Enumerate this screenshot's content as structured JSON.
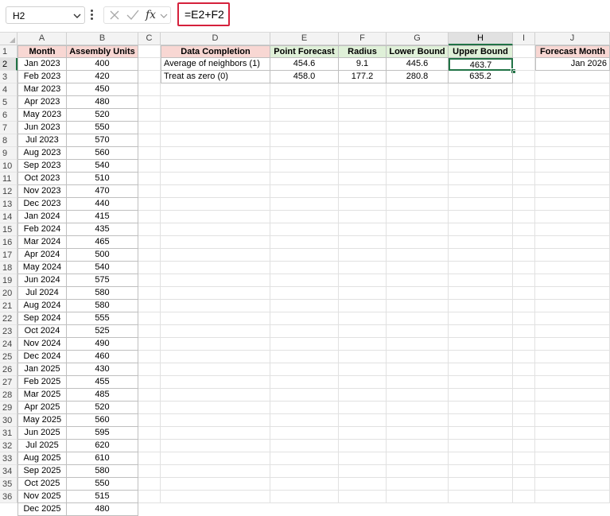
{
  "formula_bar": {
    "name_box": "H2",
    "formula": "=E2+F2",
    "fx_label": "fx",
    "icons": [
      "chevron-down-icon",
      "more-dots-icon",
      "cancel-x-icon",
      "confirm-check-icon",
      "function-fx-icon"
    ]
  },
  "columns": [
    "A",
    "B",
    "C",
    "D",
    "E",
    "F",
    "G",
    "H",
    "I",
    "J"
  ],
  "row_numbers": [
    "1",
    "2",
    "3",
    "4",
    "5",
    "6",
    "7",
    "8",
    "9",
    "10",
    "11",
    "12",
    "13",
    "14",
    "15",
    "16",
    "17",
    "18",
    "19",
    "20",
    "21",
    "22",
    "23",
    "24",
    "25",
    "26",
    "27",
    "28",
    "29",
    "30",
    "31",
    "32",
    "33",
    "34",
    "35",
    "36"
  ],
  "table_a": {
    "headers": [
      "Month",
      "Assembly Units"
    ],
    "rows": [
      [
        "Jan 2023",
        "400"
      ],
      [
        "Feb 2023",
        "420"
      ],
      [
        "Mar 2023",
        "450"
      ],
      [
        "Apr 2023",
        "480"
      ],
      [
        "May 2023",
        "520"
      ],
      [
        "Jun 2023",
        "550"
      ],
      [
        "Jul 2023",
        "570"
      ],
      [
        "Aug 2023",
        "560"
      ],
      [
        "Sep 2023",
        "540"
      ],
      [
        "Oct 2023",
        "510"
      ],
      [
        "Nov 2023",
        "470"
      ],
      [
        "Dec 2023",
        "440"
      ],
      [
        "Jan 2024",
        "415"
      ],
      [
        "Feb 2024",
        "435"
      ],
      [
        "Mar 2024",
        "465"
      ],
      [
        "Apr 2024",
        "500"
      ],
      [
        "May 2024",
        "540"
      ],
      [
        "Jun 2024",
        "575"
      ],
      [
        "Jul 2024",
        "580"
      ],
      [
        "Aug 2024",
        "580"
      ],
      [
        "Sep 2024",
        "555"
      ],
      [
        "Oct 2024",
        "525"
      ],
      [
        "Nov 2024",
        "490"
      ],
      [
        "Dec 2024",
        "460"
      ],
      [
        "Jan 2025",
        "430"
      ],
      [
        "Feb 2025",
        "455"
      ],
      [
        "Mar 2025",
        "485"
      ],
      [
        "Apr 2025",
        "520"
      ],
      [
        "May 2025",
        "560"
      ],
      [
        "Jun 2025",
        "595"
      ],
      [
        "Jul 2025",
        "620"
      ],
      [
        "Aug 2025",
        "610"
      ],
      [
        "Sep 2025",
        "580"
      ],
      [
        "Oct 2025",
        "550"
      ],
      [
        "Nov 2025",
        "515"
      ],
      [
        "Dec 2025",
        "480"
      ]
    ]
  },
  "table_d": {
    "headers": [
      "Data Completion",
      "Point Forecast",
      "Radius",
      "Lower Bound",
      "Upper Bound"
    ],
    "rows": [
      [
        "Average of neighbors (1)",
        "454.6",
        "9.1",
        "445.6",
        "463.7"
      ],
      [
        "Treat as zero (0)",
        "458.0",
        "177.2",
        "280.8",
        "635.2"
      ]
    ]
  },
  "table_j": {
    "header": "Forecast Month",
    "value": "Jan 2026"
  },
  "colors": {
    "header_pink": "#f8d7d3",
    "header_green": "#dff0d8",
    "selection_green": "#217346",
    "formula_highlight_red": "#d5213c"
  }
}
